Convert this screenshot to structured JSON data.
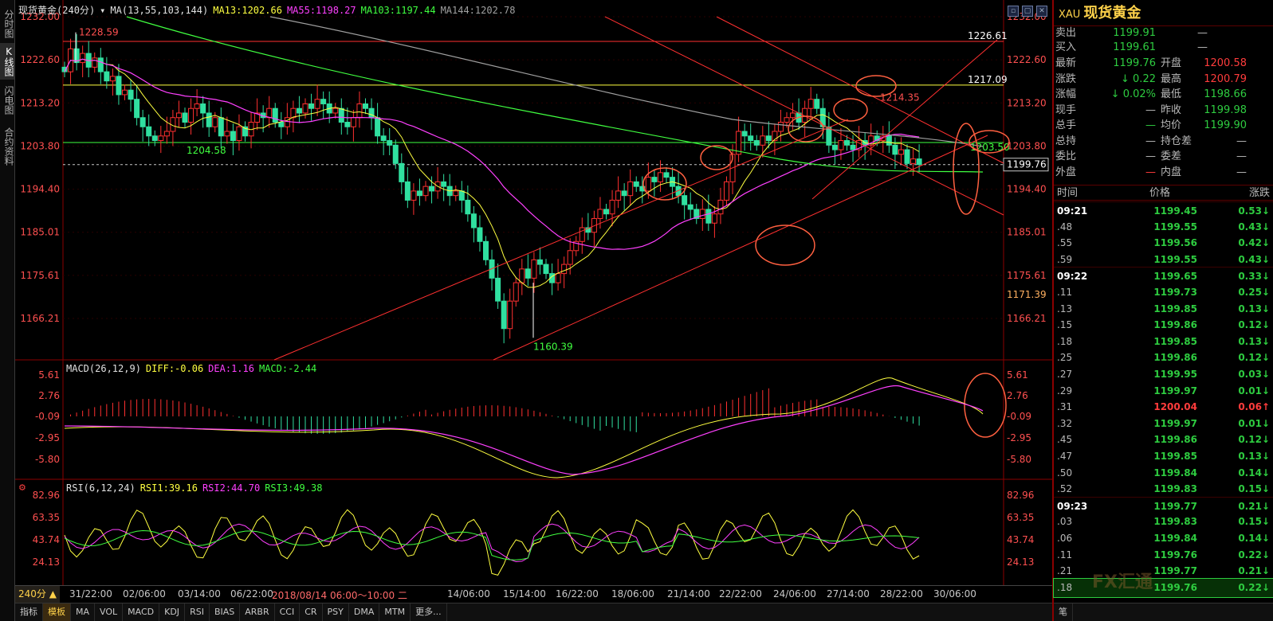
{
  "left_tabs": [
    {
      "label": "分时图",
      "active": false
    },
    {
      "label": "K线图",
      "active": true
    },
    {
      "label": "闪电图",
      "active": false
    },
    {
      "label": "合约资料",
      "active": false
    }
  ],
  "header": {
    "instrument": "现货黄金",
    "period": "240分",
    "ma_label": "MA(13,55,103,144)",
    "ma13": "MA13:1202.66",
    "ma55": "MA55:1198.27",
    "ma103": "MA103:1197.44",
    "ma144": "MA144:1202.78",
    "colors": {
      "ma13": "#ffff40",
      "ma55": "#ff40ff",
      "ma103": "#40ff40",
      "ma144": "#a0a0a0"
    }
  },
  "price_axis": {
    "ticks": [
      "1232.00",
      "1222.60",
      "1213.20",
      "1203.80",
      "1194.40",
      "1185.01",
      "1175.61",
      "1166.21"
    ],
    "current": "1199.76",
    "marker": "1171.39"
  },
  "annotations": {
    "high": "1228.59",
    "low": "1160.39",
    "level1": "1204.58",
    "h_line_red": "1226.61",
    "h_line_yellow": "1217.09",
    "peak": "1214.35",
    "mark2": "1203.50"
  },
  "macd": {
    "label": "MACD(26,12,9)",
    "diff": "DIFF:-0.06",
    "dea": "DEA:1.16",
    "macd": "MACD:-2.44",
    "ticks": [
      "5.61",
      "2.76",
      "-0.09",
      "-2.95",
      "-5.80"
    ]
  },
  "rsi": {
    "label": "RSI(6,12,24)",
    "rsi1": "RSI1:39.16",
    "rsi2": "RSI2:44.70",
    "rsi3": "RSI3:49.38",
    "ticks": [
      "82.96",
      "63.35",
      "43.74",
      "24.13"
    ]
  },
  "time_axis": {
    "period_button": "240分 ▲",
    "labels": [
      "31/22:00",
      "02/06:00",
      "03/14:00",
      "06/22:00",
      "2018/08/14  06:00～10:00  二",
      "14/06:00",
      "15/14:00",
      "16/22:00",
      "18/06:00",
      "21/14:00",
      "22/22:00",
      "24/06:00",
      "27/14:00",
      "28/22:00",
      "30/06:00"
    ]
  },
  "bottom_tabs": [
    "指标",
    "模板",
    "MA",
    "VOL",
    "MACD",
    "KDJ",
    "RSI",
    "BIAS",
    "ARBR",
    "CCI",
    "CR",
    "PSY",
    "DMA",
    "MTM",
    "更多..."
  ],
  "quote": {
    "code": "XAU",
    "name": "现货黄金",
    "sell_label": "卖出",
    "sell": "1199.91",
    "sell_vol": "—",
    "buy_label": "买入",
    "buy": "1199.61",
    "buy_vol": "—",
    "rows": [
      {
        "l1": "最新",
        "v1": "1199.76",
        "l2": "开盘",
        "v2": "1200.58"
      },
      {
        "l1": "涨跌",
        "v1": "↓ 0.22",
        "l2": "最高",
        "v2": "1200.79"
      },
      {
        "l1": "涨幅",
        "v1": "↓ 0.02%",
        "l2": "最低",
        "v2": "1198.66"
      },
      {
        "l1": "现手",
        "v1": "—",
        "l2": "昨收",
        "v2": "1199.98"
      },
      {
        "l1": "总手",
        "v1": "—",
        "l2": "均价",
        "v2": "1199.90"
      },
      {
        "l1": "总持",
        "v1": "—",
        "l2": "持仓差",
        "v2": "—"
      },
      {
        "l1": "委比",
        "v1": "—",
        "l2": "委差",
        "v2": "—"
      },
      {
        "l1": "外盘",
        "v1": "—",
        "l2": "内盘",
        "v2": "—"
      }
    ]
  },
  "ticks": {
    "header": {
      "time": "时间",
      "price": "价格",
      "change": "涨跌"
    },
    "rows": [
      {
        "time": "09:21",
        "price": "1199.45",
        "change": "0.53↓",
        "dir": "dn",
        "min": true
      },
      {
        "time": ".48",
        "price": "1199.55",
        "change": "0.43↓",
        "dir": "dn"
      },
      {
        "time": ".55",
        "price": "1199.56",
        "change": "0.42↓",
        "dir": "dn"
      },
      {
        "time": ".59",
        "price": "1199.55",
        "change": "0.43↓",
        "dir": "dn"
      },
      {
        "time": "09:22",
        "price": "1199.65",
        "change": "0.33↓",
        "dir": "dn",
        "min": true
      },
      {
        "time": ".11",
        "price": "1199.73",
        "change": "0.25↓",
        "dir": "dn"
      },
      {
        "time": ".13",
        "price": "1199.85",
        "change": "0.13↓",
        "dir": "dn"
      },
      {
        "time": ".15",
        "price": "1199.86",
        "change": "0.12↓",
        "dir": "dn"
      },
      {
        "time": ".18",
        "price": "1199.85",
        "change": "0.13↓",
        "dir": "dn"
      },
      {
        "time": ".25",
        "price": "1199.86",
        "change": "0.12↓",
        "dir": "dn"
      },
      {
        "time": ".27",
        "price": "1199.95",
        "change": "0.03↓",
        "dir": "dn"
      },
      {
        "time": ".29",
        "price": "1199.97",
        "change": "0.01↓",
        "dir": "dn"
      },
      {
        "time": ".31",
        "price": "1200.04",
        "change": "0.06↑",
        "dir": "up"
      },
      {
        "time": ".32",
        "price": "1199.97",
        "change": "0.01↓",
        "dir": "dn"
      },
      {
        "time": ".45",
        "price": "1199.86",
        "change": "0.12↓",
        "dir": "dn"
      },
      {
        "time": ".47",
        "price": "1199.85",
        "change": "0.13↓",
        "dir": "dn"
      },
      {
        "time": ".50",
        "price": "1199.84",
        "change": "0.14↓",
        "dir": "dn"
      },
      {
        "time": ".52",
        "price": "1199.83",
        "change": "0.15↓",
        "dir": "dn"
      },
      {
        "time": "09:23",
        "price": "1199.77",
        "change": "0.21↓",
        "dir": "dn",
        "min": true
      },
      {
        "time": ".03",
        "price": "1199.83",
        "change": "0.15↓",
        "dir": "dn"
      },
      {
        "time": ".06",
        "price": "1199.84",
        "change": "0.14↓",
        "dir": "dn"
      },
      {
        "time": ".11",
        "price": "1199.76",
        "change": "0.22↓",
        "dir": "dn"
      },
      {
        "time": ".21",
        "price": "1199.77",
        "change": "0.21↓",
        "dir": "dn"
      },
      {
        "time": ".18",
        "price": "1199.76",
        "change": "0.22↓",
        "dir": "dn",
        "sel": true
      }
    ]
  },
  "watermark": "FX汇通"
}
